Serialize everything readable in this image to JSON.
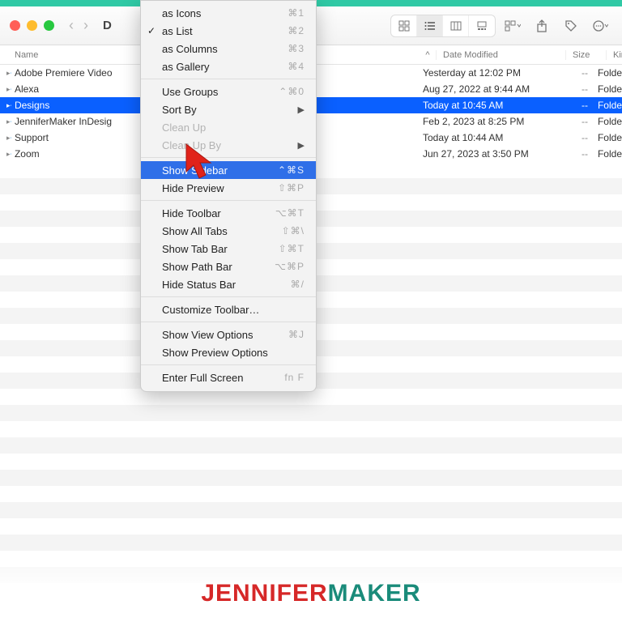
{
  "window": {
    "title_visible": "D"
  },
  "columns": {
    "name": "Name",
    "date": "Date Modified",
    "size": "Size",
    "kind": "Kind",
    "sort_indicator": "^"
  },
  "rows": [
    {
      "name": "Adobe Premiere Video",
      "date": "Yesterday at 12:02 PM",
      "size": "--",
      "kind": "Folde",
      "selected": false
    },
    {
      "name": "Alexa",
      "date": "Aug 27, 2022 at 9:44 AM",
      "size": "--",
      "kind": "Folde",
      "selected": false
    },
    {
      "name": "Designs",
      "date": "Today at 10:45 AM",
      "size": "--",
      "kind": "Folde",
      "selected": true
    },
    {
      "name": "JenniferMaker InDesig",
      "date": "Feb 2, 2023 at 8:25 PM",
      "size": "--",
      "kind": "Folde",
      "selected": false
    },
    {
      "name": "Support",
      "date": "Today at 10:44 AM",
      "size": "--",
      "kind": "Folde",
      "selected": false
    },
    {
      "name": "Zoom",
      "date": "Jun 27, 2023 at 3:50 PM",
      "size": "--",
      "kind": "Folde",
      "selected": false
    }
  ],
  "menu": {
    "groups": [
      [
        {
          "label": "as Icons",
          "shortcut": "⌘1",
          "checked": false
        },
        {
          "label": "as List",
          "shortcut": "⌘2",
          "checked": true
        },
        {
          "label": "as Columns",
          "shortcut": "⌘3",
          "checked": false
        },
        {
          "label": "as Gallery",
          "shortcut": "⌘4",
          "checked": false
        }
      ],
      [
        {
          "label": "Use Groups",
          "shortcut": "⌃⌘0"
        },
        {
          "label": "Sort By",
          "submenu": true
        },
        {
          "label": "Clean Up",
          "disabled": true
        },
        {
          "label": "Clean Up By",
          "disabled": true,
          "submenu": true
        }
      ],
      [
        {
          "label": "Show Sidebar",
          "shortcut": "⌃⌘S",
          "highlighted": true
        },
        {
          "label": "Hide Preview",
          "shortcut": "⇧⌘P"
        }
      ],
      [
        {
          "label": "Hide Toolbar",
          "shortcut": "⌥⌘T"
        },
        {
          "label": "Show All Tabs",
          "shortcut": "⇧⌘\\"
        },
        {
          "label": "Show Tab Bar",
          "shortcut": "⇧⌘T"
        },
        {
          "label": "Show Path Bar",
          "shortcut": "⌥⌘P"
        },
        {
          "label": "Hide Status Bar",
          "shortcut": "⌘/"
        }
      ],
      [
        {
          "label": "Customize Toolbar…"
        }
      ],
      [
        {
          "label": "Show View Options",
          "shortcut": "⌘J"
        },
        {
          "label": "Show Preview Options"
        }
      ],
      [
        {
          "label": "Enter Full Screen",
          "shortcut": "fn F"
        }
      ]
    ]
  },
  "brand": {
    "a": "JENNIFER",
    "b": "MAKER"
  }
}
